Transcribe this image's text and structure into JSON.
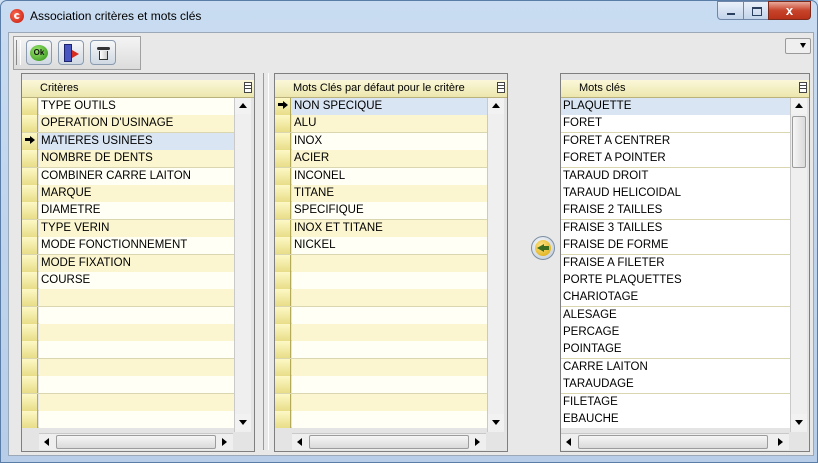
{
  "window": {
    "title": "Association critères et mots clés",
    "close_glyph": "x"
  },
  "toolbar": {
    "ok_label": "Ok"
  },
  "panel_criteres": {
    "header": "Critères",
    "selected_index": 2,
    "rows": [
      "TYPE OUTILS",
      "OPERATION D'USINAGE",
      "MATIERES USINEES",
      "NOMBRE DE DENTS",
      "COMBINER CARRE LAITON",
      "MARQUE",
      "DIAMETRE",
      "TYPE VERIN",
      "MODE FONCTIONNEMENT",
      "MODE FIXATION",
      "COURSE",
      "",
      "",
      "",
      "",
      "",
      "",
      "",
      ""
    ]
  },
  "panel_defaut": {
    "header": "Mots Clés par défaut pour le critère",
    "selected_index": 0,
    "rows": [
      "NON SPECIQUE",
      "ALU",
      "INOX",
      "ACIER",
      "INCONEL",
      "TITANE",
      "SPECIFIQUE",
      "INOX ET TITANE",
      "NICKEL",
      "",
      "",
      "",
      "",
      "",
      "",
      "",
      "",
      "",
      ""
    ]
  },
  "panel_mots": {
    "header": "Mots clés",
    "selected_index": 0,
    "rows": [
      "PLAQUETTE",
      "FORET",
      "FORET A CENTRER",
      "FORET A POINTER",
      "TARAUD DROIT",
      "TARAUD HELICOIDAL",
      "FRAISE 2 TAILLES",
      "FRAISE 3 TAILLES",
      "FRAISE DE FORME",
      "FRAISE A FILETER",
      "PORTE PLAQUETTES",
      "CHARIOTAGE",
      "ALESAGE",
      "PERCAGE",
      "POINTAGE",
      "CARRE LAITON",
      "TARAUDAGE",
      "FILETAGE",
      "EBAUCHE"
    ]
  },
  "icons": {
    "app": "app-logo-icon",
    "ok": "ok-icon",
    "exit": "exit-door-icon",
    "delete": "trash-icon",
    "transfer": "transfer-left-arrow-icon"
  }
}
